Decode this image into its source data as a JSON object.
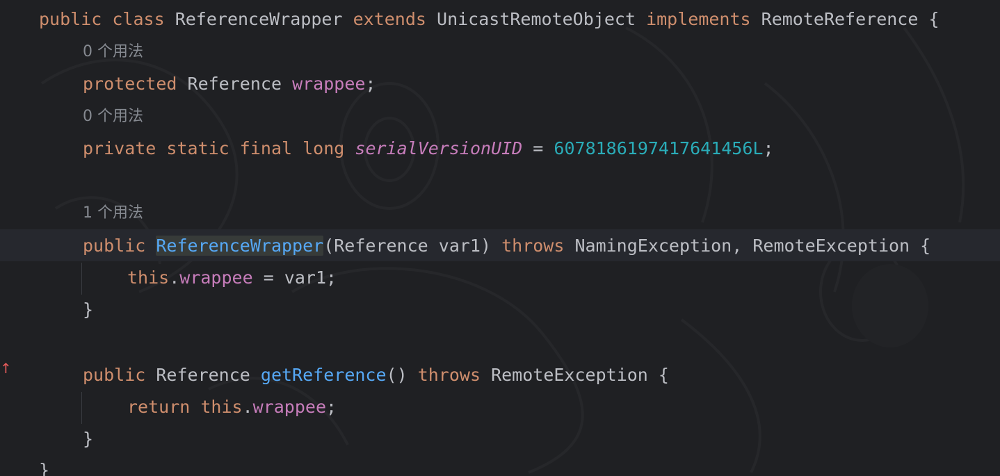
{
  "editor": {
    "lines": {
      "class_decl": {
        "public": "public",
        "class": "class",
        "name": "ReferenceWrapper",
        "extends": "extends",
        "super": "UnicastRemoteObject",
        "implements": "implements",
        "iface": "RemoteReference",
        "brace": "{"
      },
      "usage_hint_1": "0 个用法",
      "field_decl": {
        "modifier": "protected",
        "type": "Reference",
        "name": "wrappee",
        "semi": ";"
      },
      "usage_hint_2": "0 个用法",
      "serial_decl": {
        "private": "private",
        "static": "static",
        "final": "final",
        "long": "long",
        "name": "serialVersionUID",
        "eq": "=",
        "value": "6078186197417641456L",
        "semi": ";"
      },
      "usage_hint_3": "1 个用法",
      "ctor_decl": {
        "public": "public",
        "name": "ReferenceWrapper",
        "params": "(Reference var1)",
        "throws": "throws",
        "exceptions": "NamingException, RemoteException",
        "brace": "{"
      },
      "ctor_body": {
        "this": "this",
        "dot": ".",
        "field": "wrappee",
        "rest": " = var1;"
      },
      "ctor_close": "}",
      "getter_decl": {
        "public": "public",
        "type": "Reference",
        "name": "getReference",
        "parens": "()",
        "throws": "throws",
        "exception": "RemoteException",
        "brace": "{"
      },
      "getter_body": {
        "return": "return",
        "this": "this",
        "dot": ".",
        "field": "wrappee",
        "semi": ";"
      },
      "getter_close": "}",
      "class_close": "}"
    },
    "gutter": {
      "override_marker": "↑"
    },
    "colors": {
      "background": "#1f2023",
      "keyword": "#cf8e6d",
      "field": "#c77dbb",
      "number": "#2aacb8",
      "method": "#56a8f5",
      "text": "#bcbec4",
      "hint": "#868a91"
    }
  }
}
